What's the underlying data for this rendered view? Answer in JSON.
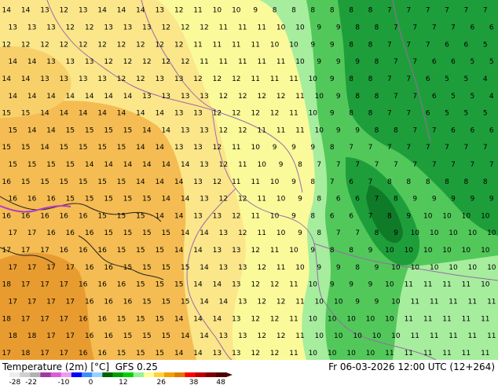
{
  "title": {
    "variable": "Temperature (2m) [°C]",
    "model": "GFS 0.25",
    "valid_time": "Fr 06-03-2026 12:00 UTC (12+264)"
  },
  "colorbar": {
    "ticks": [
      "-28",
      "-22",
      "-10",
      "0",
      "12",
      "26",
      "38",
      "48"
    ],
    "colors": [
      "#ededed",
      "#cfcfcf",
      "#b1b1b1",
      "#a03aa0",
      "#d85ed8",
      "#f19af1",
      "#0000ff",
      "#3d8cff",
      "#96d2ff",
      "#006400",
      "#00a000",
      "#00d200",
      "#96f096",
      "#ffff96",
      "#ffd23c",
      "#f0a000",
      "#e07800",
      "#ff0000",
      "#c00000",
      "#800000",
      "#500000"
    ]
  },
  "map": {
    "colors": {
      "c9": "#1e9e3a",
      "c10": "#52c85a",
      "c11": "#a6ed9e",
      "c12": "#fafa9a",
      "c13": "#fbe68a",
      "c14": "#f8d06a",
      "c15": "#f4bc52",
      "c16": "#eeac3e",
      "c17": "#e89c30",
      "c18": "#e08c28",
      "coast": "#222222",
      "border": "#9a6aa8"
    },
    "temperature_labels": [
      [
        14,
        14,
        13,
        12,
        13,
        14,
        14,
        14,
        13,
        12,
        11,
        10,
        10,
        9,
        8,
        8,
        8,
        8,
        8,
        8,
        7,
        7,
        7,
        7,
        7,
        7
      ],
      [
        13,
        13,
        13,
        12,
        12,
        13,
        13,
        13,
        12,
        12,
        12,
        11,
        11,
        11,
        10,
        10,
        9,
        9,
        8,
        8,
        7,
        7,
        7,
        7,
        6,
        6
      ],
      [
        12,
        12,
        12,
        12,
        12,
        12,
        12,
        12,
        12,
        12,
        11,
        11,
        11,
        11,
        10,
        10,
        9,
        9,
        8,
        8,
        7,
        7,
        7,
        6,
        6,
        5
      ],
      [
        14,
        14,
        13,
        13,
        13,
        12,
        12,
        12,
        12,
        12,
        11,
        11,
        11,
        11,
        11,
        10,
        9,
        9,
        9,
        8,
        7,
        7,
        6,
        6,
        5,
        5
      ],
      [
        14,
        14,
        13,
        13,
        13,
        13,
        12,
        12,
        13,
        13,
        12,
        12,
        12,
        11,
        11,
        11,
        10,
        9,
        8,
        8,
        7,
        7,
        6,
        5,
        5,
        4
      ],
      [
        14,
        14,
        14,
        14,
        14,
        14,
        14,
        13,
        13,
        13,
        13,
        12,
        12,
        12,
        12,
        11,
        10,
        9,
        8,
        8,
        7,
        7,
        6,
        5,
        5,
        4
      ],
      [
        15,
        15,
        14,
        14,
        14,
        14,
        14,
        14,
        14,
        13,
        13,
        12,
        12,
        12,
        12,
        11,
        10,
        9,
        8,
        8,
        7,
        7,
        6,
        5,
        5,
        5
      ],
      [
        15,
        14,
        14,
        15,
        15,
        15,
        15,
        14,
        14,
        13,
        13,
        12,
        12,
        11,
        11,
        11,
        10,
        9,
        9,
        8,
        8,
        7,
        7,
        6,
        6,
        6
      ],
      [
        15,
        15,
        14,
        15,
        15,
        15,
        15,
        14,
        14,
        13,
        13,
        12,
        11,
        10,
        9,
        9,
        9,
        8,
        7,
        7,
        7,
        7,
        7,
        7,
        7,
        7
      ],
      [
        15,
        15,
        15,
        15,
        14,
        14,
        14,
        14,
        14,
        14,
        13,
        12,
        11,
        10,
        9,
        8,
        7,
        7,
        7,
        7,
        7,
        7,
        7,
        7,
        7,
        7
      ],
      [
        16,
        15,
        15,
        15,
        15,
        15,
        15,
        14,
        14,
        14,
        13,
        12,
        11,
        11,
        10,
        9,
        8,
        7,
        6,
        7,
        8,
        8,
        8,
        8,
        8,
        8
      ],
      [
        16,
        16,
        16,
        15,
        15,
        15,
        15,
        15,
        14,
        14,
        13,
        12,
        12,
        11,
        10,
        9,
        8,
        6,
        6,
        7,
        8,
        9,
        9,
        9,
        9,
        9
      ],
      [
        16,
        16,
        16,
        16,
        16,
        15,
        15,
        15,
        14,
        14,
        13,
        13,
        12,
        11,
        10,
        9,
        8,
        6,
        6,
        7,
        8,
        9,
        10,
        10,
        10,
        10
      ],
      [
        17,
        17,
        16,
        16,
        16,
        15,
        15,
        15,
        15,
        14,
        14,
        13,
        12,
        11,
        10,
        9,
        8,
        7,
        7,
        8,
        9,
        10,
        10,
        10,
        10,
        10
      ],
      [
        17,
        17,
        17,
        16,
        16,
        16,
        15,
        15,
        15,
        14,
        14,
        13,
        13,
        12,
        11,
        10,
        9,
        8,
        8,
        9,
        10,
        10,
        10,
        10,
        10,
        10
      ],
      [
        17,
        17,
        17,
        17,
        16,
        16,
        15,
        15,
        15,
        15,
        14,
        13,
        13,
        12,
        11,
        10,
        9,
        9,
        8,
        9,
        10,
        10,
        10,
        10,
        10,
        10
      ],
      [
        18,
        17,
        17,
        17,
        16,
        16,
        16,
        15,
        15,
        15,
        14,
        14,
        13,
        12,
        12,
        11,
        10,
        9,
        9,
        9,
        10,
        11,
        11,
        11,
        11,
        10
      ],
      [
        17,
        17,
        17,
        17,
        16,
        16,
        16,
        15,
        15,
        15,
        14,
        14,
        13,
        12,
        12,
        11,
        10,
        10,
        9,
        9,
        10,
        11,
        11,
        11,
        11,
        11
      ],
      [
        18,
        17,
        17,
        17,
        16,
        16,
        15,
        15,
        15,
        14,
        14,
        14,
        13,
        12,
        12,
        11,
        10,
        10,
        10,
        10,
        10,
        11,
        11,
        11,
        11,
        11
      ],
      [
        18,
        18,
        17,
        17,
        16,
        16,
        15,
        15,
        15,
        14,
        14,
        13,
        13,
        12,
        12,
        11,
        10,
        10,
        10,
        10,
        10,
        11,
        11,
        11,
        11,
        11
      ],
      [
        17,
        18,
        17,
        17,
        16,
        16,
        15,
        15,
        15,
        14,
        14,
        13,
        13,
        12,
        12,
        11,
        10,
        10,
        10,
        10,
        11,
        11,
        11,
        11,
        11,
        11
      ]
    ]
  }
}
